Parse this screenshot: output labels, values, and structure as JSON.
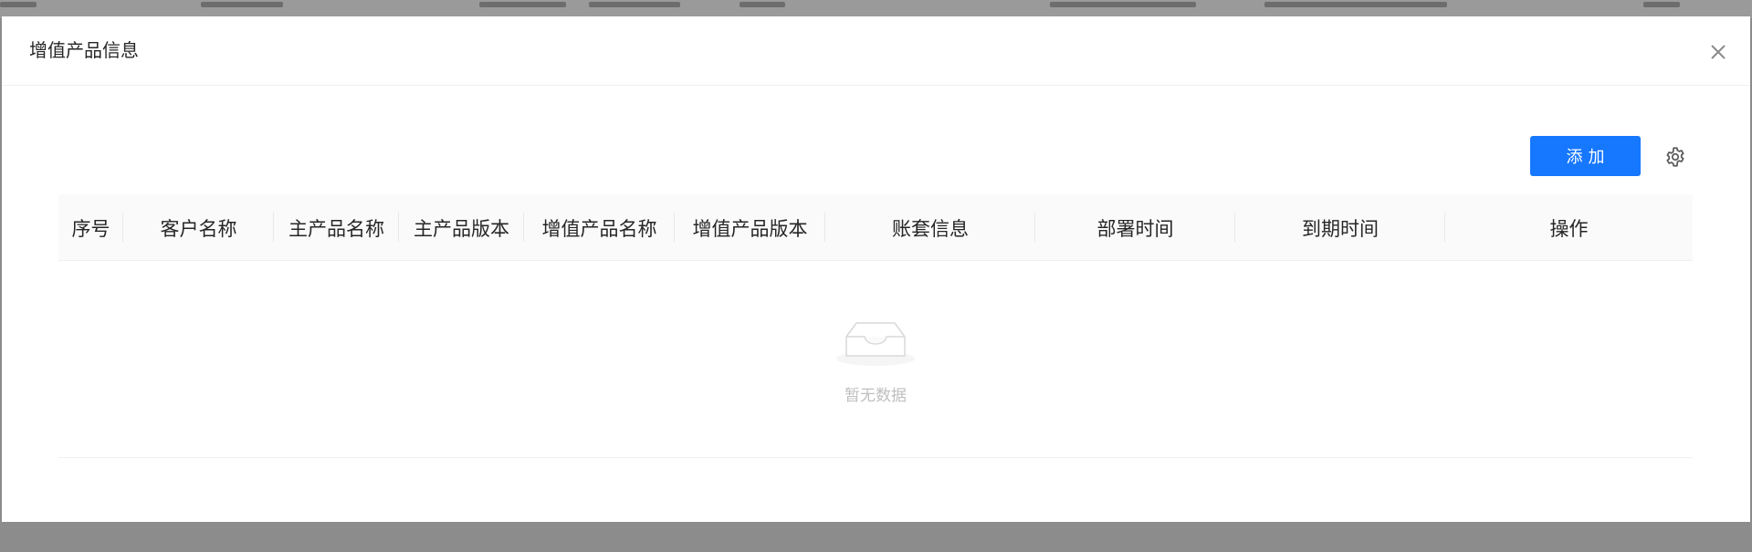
{
  "modal": {
    "title": "增值产品信息"
  },
  "toolbar": {
    "add_label": "添加",
    "settings_icon": "gear-icon"
  },
  "table": {
    "columns": [
      {
        "key": "index",
        "label": "序号"
      },
      {
        "key": "customer_name",
        "label": "客户名称"
      },
      {
        "key": "main_product_name",
        "label": "主产品名称"
      },
      {
        "key": "main_product_version",
        "label": "主产品版本"
      },
      {
        "key": "addon_product_name",
        "label": "增值产品名称"
      },
      {
        "key": "addon_product_version",
        "label": "增值产品版本"
      },
      {
        "key": "account_set_info",
        "label": "账套信息"
      },
      {
        "key": "deploy_time",
        "label": "部署时间"
      },
      {
        "key": "expire_time",
        "label": "到期时间"
      },
      {
        "key": "actions",
        "label": "操作"
      }
    ],
    "rows": [],
    "empty_text": "暂无数据"
  },
  "colors": {
    "primary": "#1677ff",
    "header_bg": "#fafafa",
    "border": "#f0f0f0",
    "muted_text": "#bfbfbf"
  }
}
